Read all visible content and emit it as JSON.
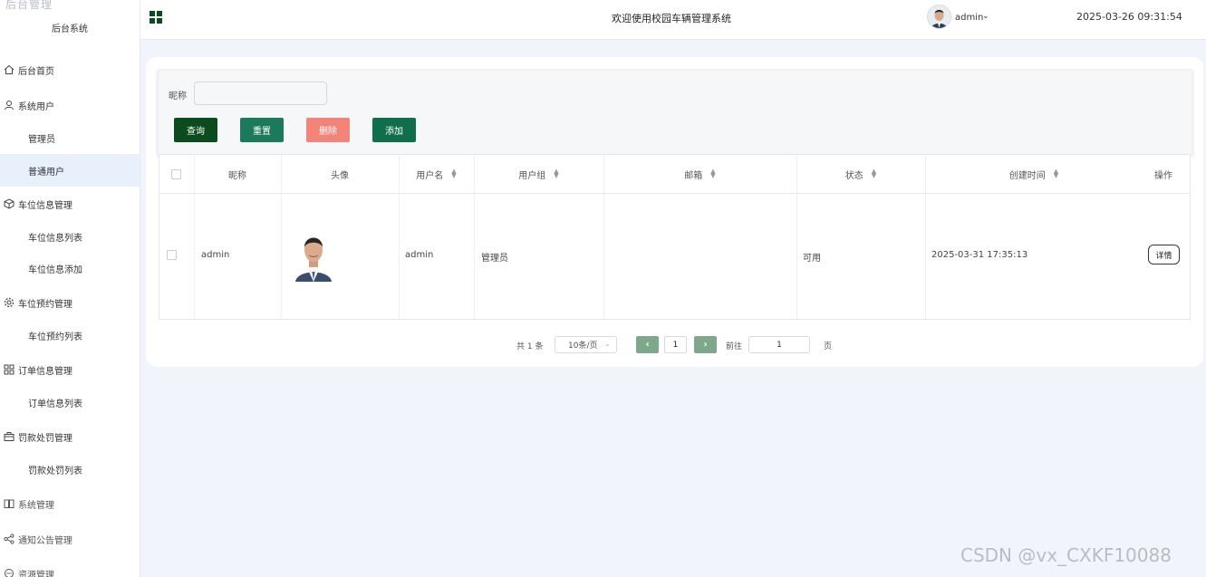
{
  "sidebar": {
    "logo_text": "后台管理",
    "subtitle": "后台系统",
    "items": [
      {
        "label": "后台首页",
        "icon": "home-icon",
        "level": 1
      },
      {
        "label": "系统用户",
        "icon": "user-icon",
        "level": 1
      },
      {
        "label": "管理员",
        "level": 2
      },
      {
        "label": "普通用户",
        "level": 2,
        "active": true
      },
      {
        "label": "车位信息管理",
        "icon": "cube-icon",
        "level": 1
      },
      {
        "label": "车位信息列表",
        "level": 2
      },
      {
        "label": "车位信息添加",
        "level": 2
      },
      {
        "label": "车位预约管理",
        "icon": "gear-icon",
        "level": 1
      },
      {
        "label": "车位预约列表",
        "level": 2
      },
      {
        "label": "订单信息管理",
        "icon": "grid-icon",
        "level": 1
      },
      {
        "label": "订单信息列表",
        "level": 2
      },
      {
        "label": "罚款处罚管理",
        "icon": "bag-icon",
        "level": 1
      },
      {
        "label": "罚款处罚列表",
        "level": 2
      },
      {
        "label": "系统管理",
        "icon": "book-icon",
        "level": 1
      },
      {
        "label": "通知公告管理",
        "icon": "share-icon",
        "level": 1
      },
      {
        "label": "资源管理",
        "icon": "circle-icon",
        "level": 1
      }
    ]
  },
  "header": {
    "title": "欢迎使用校园车辆管理系统",
    "user": "admin",
    "datetime": "2025-03-26 09:31:54"
  },
  "search": {
    "label": "昵称",
    "value": "",
    "buttons": {
      "query": "查询",
      "reset": "重置",
      "delete": "删除",
      "add": "添加"
    }
  },
  "table": {
    "columns": [
      "昵称",
      "头像",
      "用户名",
      "用户组",
      "邮箱",
      "状态",
      "创建时间",
      "操作"
    ],
    "rows": [
      {
        "nickname": "admin",
        "username": "admin",
        "group": "管理员",
        "email": "",
        "status": "可用",
        "created": "2025-03-31 17:35:13",
        "action": "详情"
      }
    ]
  },
  "pagination": {
    "total": "共 1 条",
    "page_size": "10条/页",
    "current_page": "1",
    "goto_label": "前往",
    "goto_value": "1",
    "page_suffix": "页"
  },
  "watermark": "CSDN @vx_CXKF10088",
  "colors": {
    "query_btn": "#0c4b1e",
    "reset_btn": "#1a7a5a",
    "delete_btn": "#f2847a",
    "add_btn": "#0f6e4c",
    "page_btn": "#7da98a",
    "background": "#f1f4fa"
  }
}
